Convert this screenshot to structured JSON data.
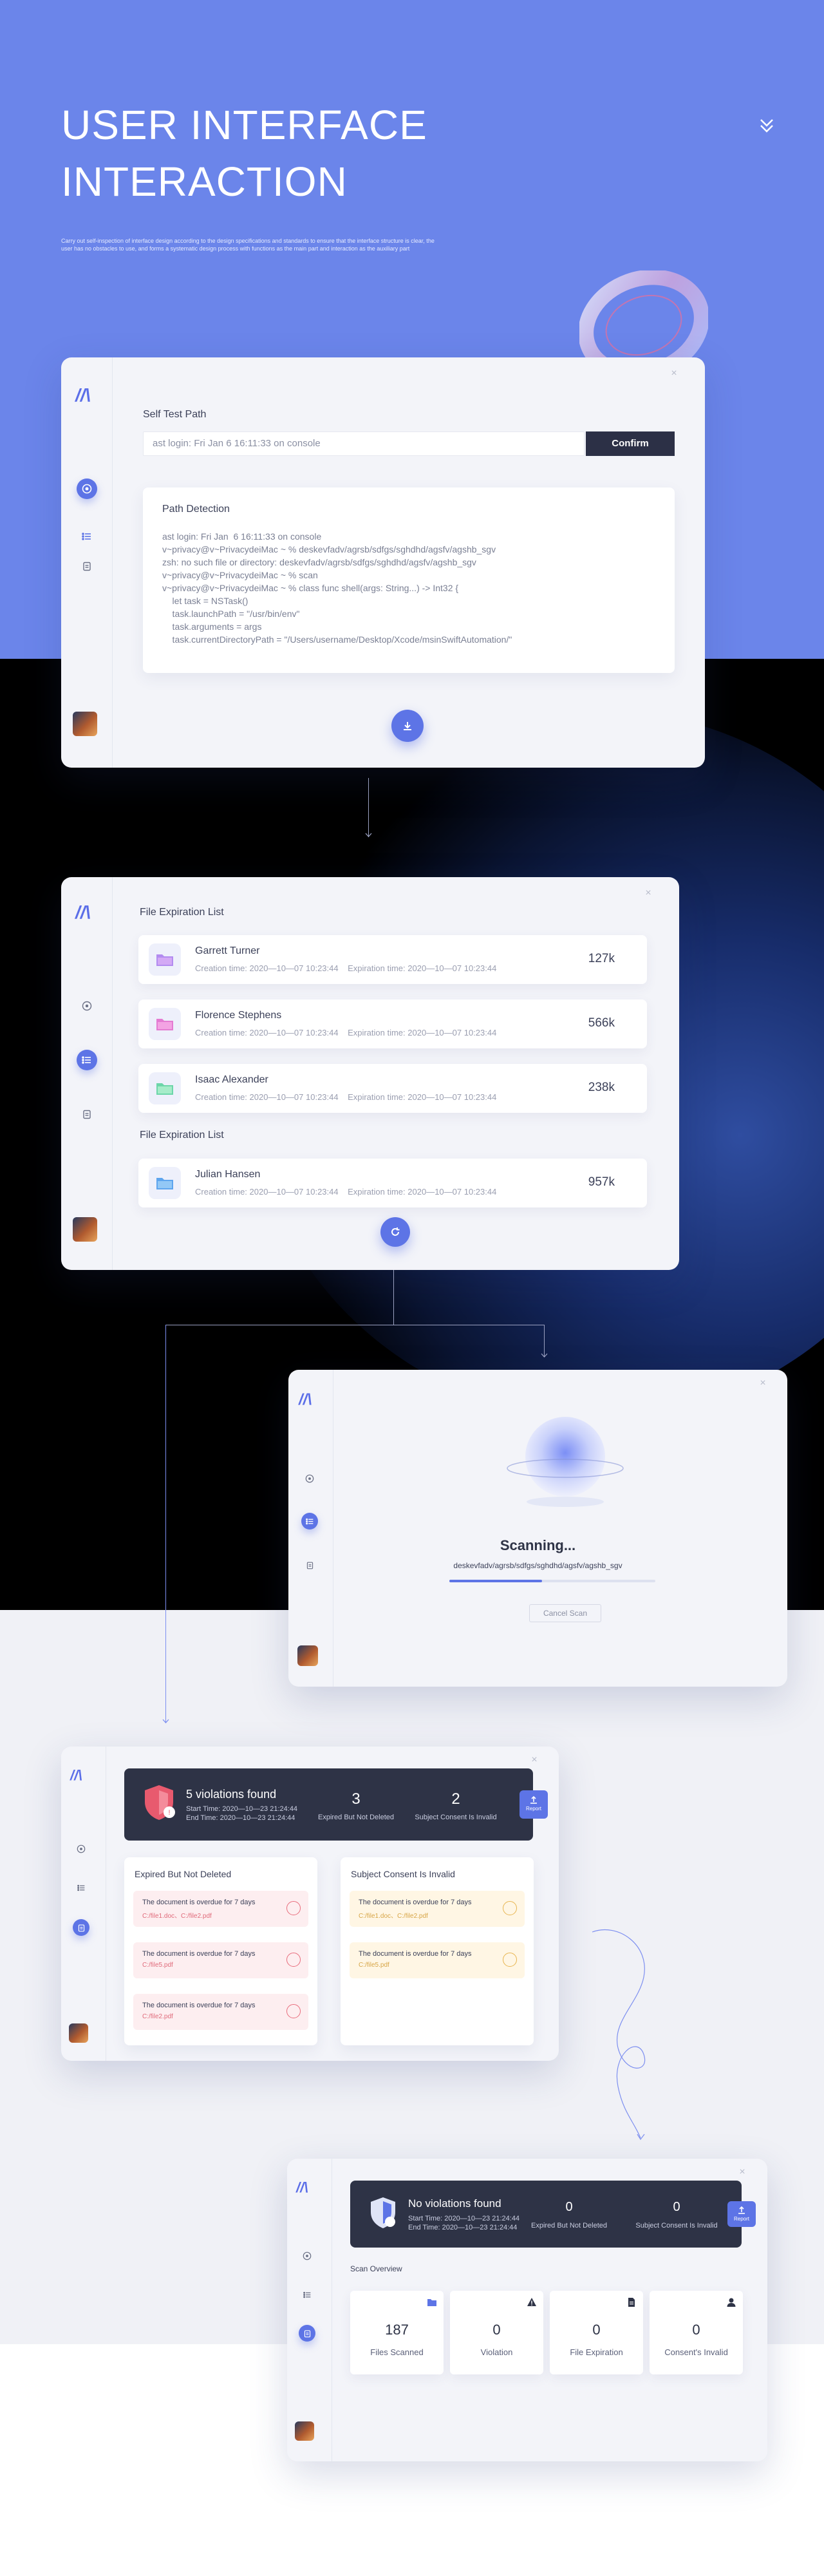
{
  "hero": {
    "title_line1": "USER INTERFACE",
    "title_line2": "INTERACTION",
    "description": "Carry out self-inspection of interface design according to the design specifications and standards to ensure that the interface structure is clear, the user has no obstacles to use, and forms a systematic design process with functions as the main part and interaction as the auxiliary part"
  },
  "colors": {
    "primary": "#6b85ea",
    "accent": "#5d74e6",
    "dark": "#2c3046",
    "danger": "#e86c7c",
    "warning": "#e8b550"
  },
  "self_test": {
    "label": "Self Test Path",
    "input_value": "ast login: Fri Jan  6 16:11:33 on console",
    "confirm": "Confirm",
    "panel_title": "Path Detection",
    "code": "ast login: Fri Jan  6 16:11:33 on console\nv~privacy@v~PrivacydeiMac ~ % deskevfadv/agrsb/sdfgs/sghdhd/agsfv/agshb_sgv\nzsh: no such file or directory: deskevfadv/agrsb/sdfgs/sghdhd/agsfv/agshb_sgv\nv~privacy@v~PrivacydeiMac ~ % scan\nv~privacy@v~PrivacydeiMac ~ % class func shell(args: String...) -> Int32 {\n    let task = NSTask()\n    task.launchPath = \"/usr/bin/env\"\n    task.arguments = args\n    task.currentDirectoryPath = \"/Users/username/Desktop/Xcode/msinSwiftAutomation/\""
  },
  "file_list": {
    "heading1": "File Expiration List",
    "heading2": "File Expiration List",
    "creation_label": "Creation time:",
    "expiration_label": "Expiration time:",
    "files": [
      {
        "name": "Garrett Turner",
        "creation": "2020—10—07 10:23:44",
        "expiration": "2020—10—07 10:23:44",
        "size": "127k"
      },
      {
        "name": "Florence Stephens",
        "creation": "2020—10—07 10:23:44",
        "expiration": "2020—10—07 10:23:44",
        "size": "566k"
      },
      {
        "name": "Isaac Alexander",
        "creation": "2020—10—07 10:23:44",
        "expiration": "2020—10—07 10:23:44",
        "size": "238k"
      },
      {
        "name": "Julian Hansen",
        "creation": "2020—10—07 10:23:44",
        "expiration": "2020—10—07 10:23:44",
        "size": "957k"
      }
    ]
  },
  "scanning": {
    "title": "Scanning...",
    "path": "deskevfadv/agrsb/sdfgs/sghdhd/agsfv/agshb_sgv",
    "progress": 0.45,
    "cancel": "Cancel Scan"
  },
  "violations": {
    "title": "5 violations found",
    "start": "Start Time:   2020—10—23 21:24:44",
    "end": "End Time:   2020—10—23 21:24:44",
    "stat1_num": "3",
    "stat1_cap": "Expired But Not Deleted",
    "stat2_num": "2",
    "stat2_cap": "Subject Consent Is Invalid",
    "report": "Report",
    "col1_title": "Expired But Not Deleted",
    "col2_title": "Subject Consent Is Invalid",
    "col1_items": [
      {
        "text": "The document is overdue for 7 days",
        "files": "C:/file1.doc、C:/file2.pdf"
      },
      {
        "text": "The document is overdue for 7 days",
        "files": "C:/file5.pdf"
      },
      {
        "text": "The document is overdue for 7 days",
        "files": "C:/file2.pdf"
      }
    ],
    "col2_items": [
      {
        "text": "The document is overdue for 7 days",
        "files": "C:/file1.doc、C:/file2.pdf"
      },
      {
        "text": "The document is overdue for 7 days",
        "files": "C:/file5.pdf"
      }
    ]
  },
  "no_violations": {
    "title": "No violations found",
    "start": "Start Time:   2020—10—23 21:24:44",
    "end": "End Time:   2020—10—23 21:24:44",
    "stat1_num": "0",
    "stat1_cap": "Expired But Not Deleted",
    "stat2_num": "0",
    "stat2_cap": "Subject Consent Is Invalid",
    "report": "Report",
    "overview": "Scan Overview",
    "stats": [
      {
        "num": "187",
        "cap": "Files Scanned",
        "icon": "folder-icon"
      },
      {
        "num": "0",
        "cap": "Violation",
        "icon": "warning-icon"
      },
      {
        "num": "0",
        "cap": "File Expiration",
        "icon": "document-icon"
      },
      {
        "num": "0",
        "cap": "Consent's Invalid",
        "icon": "user-icon"
      }
    ]
  }
}
